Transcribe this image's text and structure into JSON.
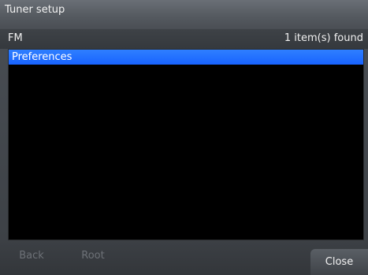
{
  "window": {
    "title": "Tuner setup"
  },
  "subheader": {
    "left_label": "FM",
    "status": "1 item(s) found"
  },
  "list": {
    "items": [
      {
        "label": "Preferences",
        "selected": true
      }
    ]
  },
  "bottom_bar": {
    "back_label": "Back",
    "root_label": "Root",
    "close_label": "Close"
  },
  "colors": {
    "selection": "#1863ff",
    "background": "#000000",
    "chrome": "#4a4f55"
  }
}
